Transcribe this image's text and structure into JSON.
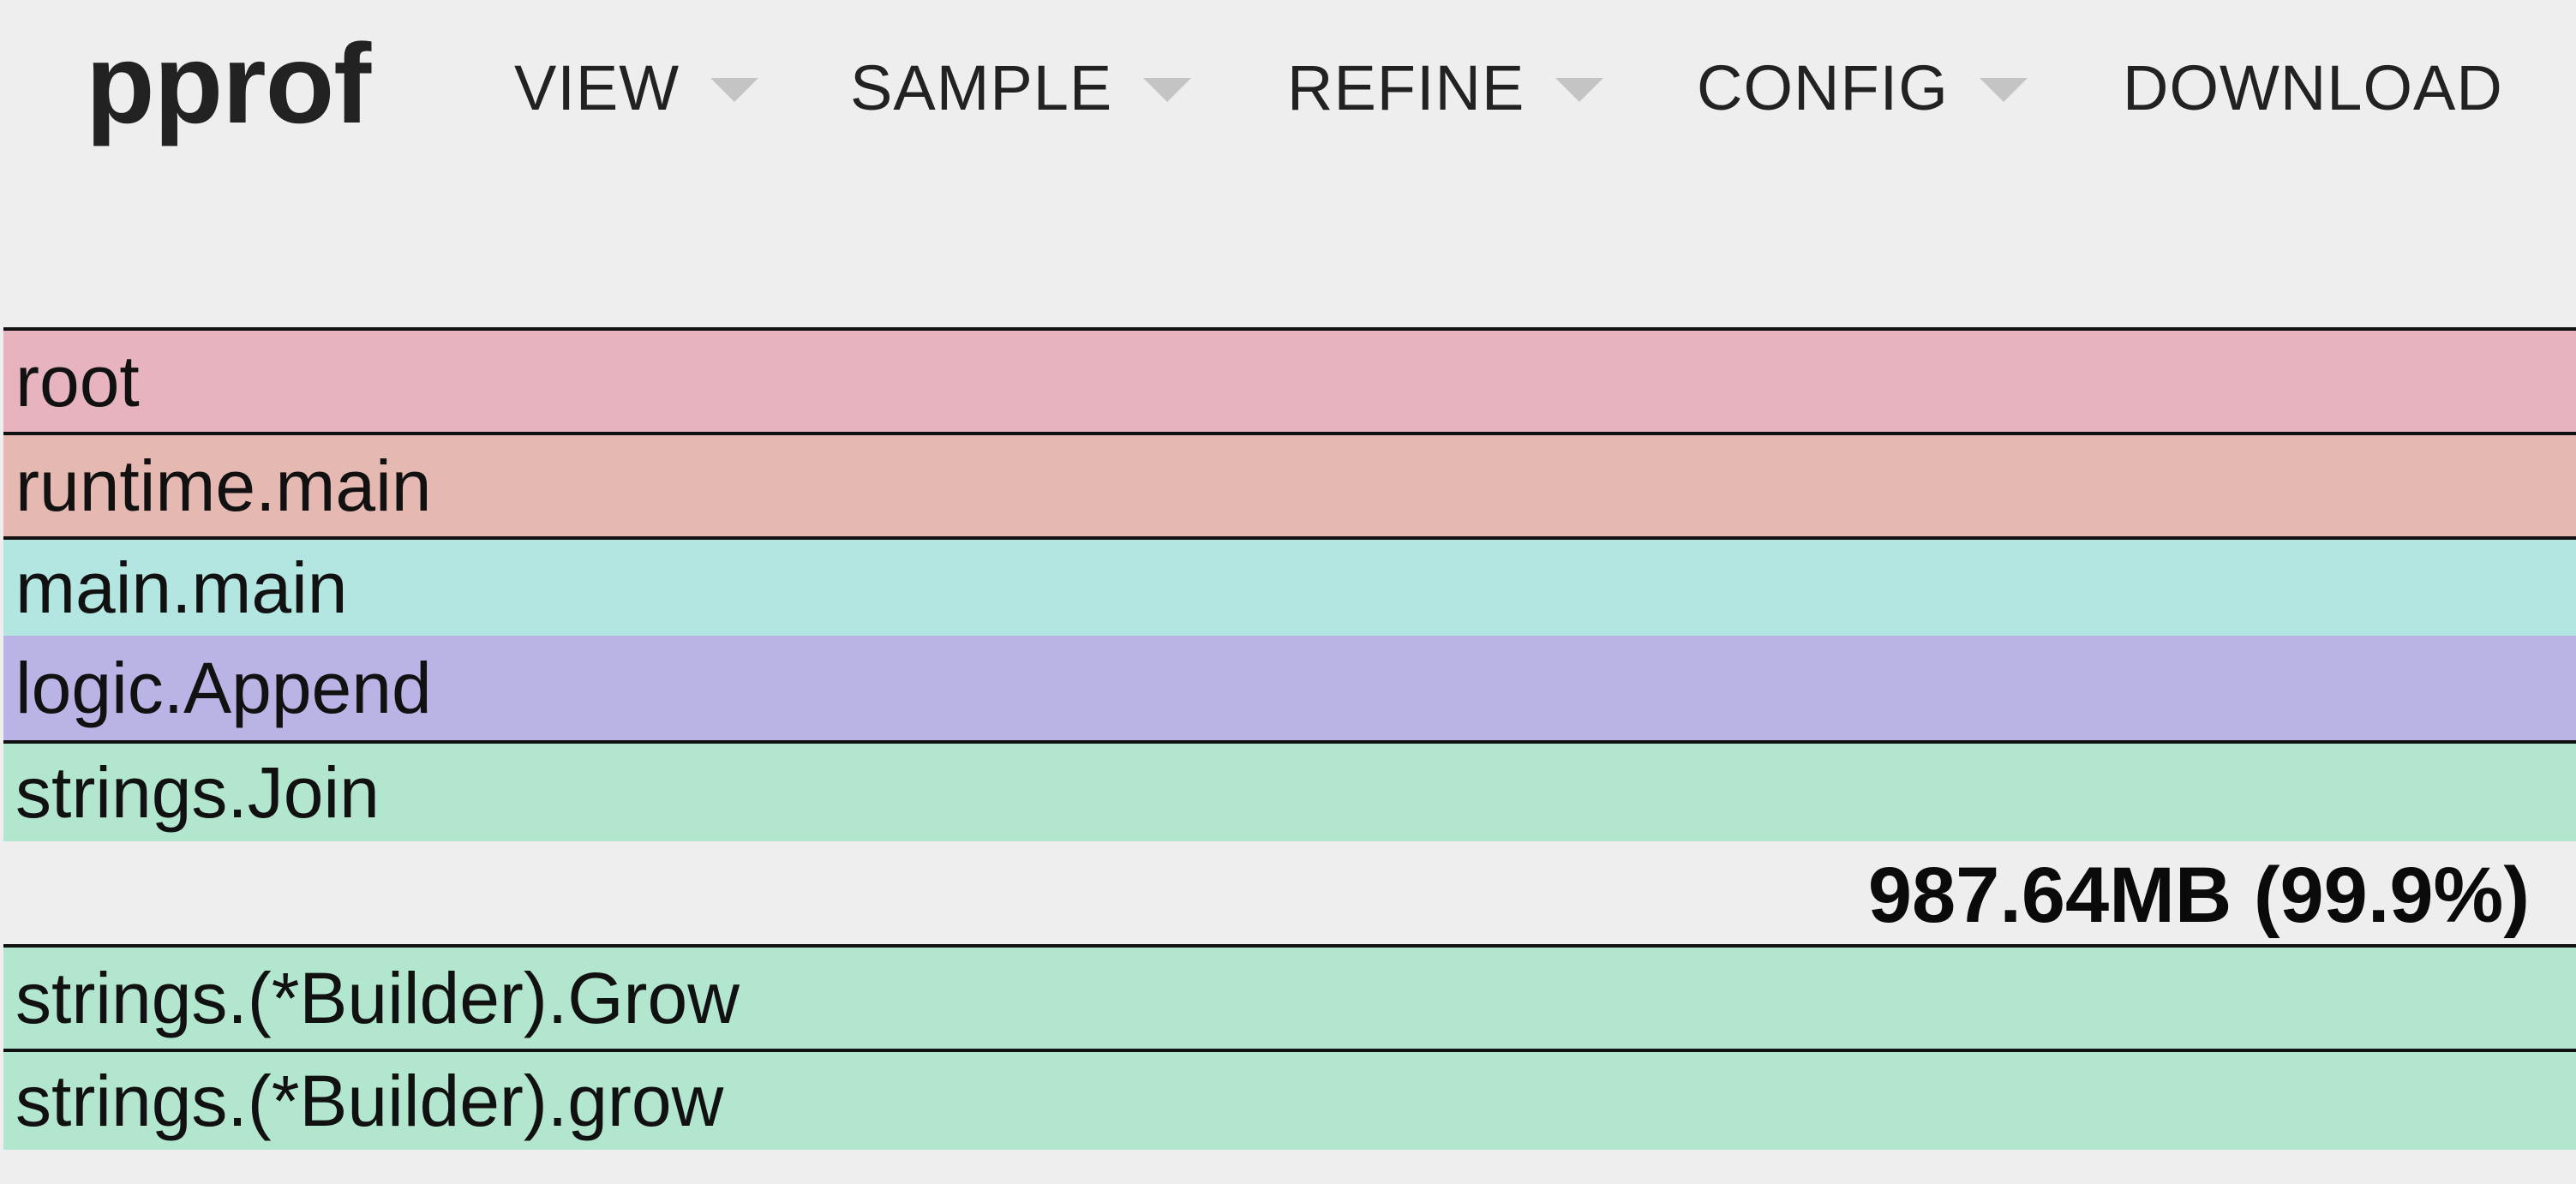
{
  "header": {
    "logo": "pprof",
    "menus": [
      {
        "label": "VIEW",
        "has_dropdown": true
      },
      {
        "label": "SAMPLE",
        "has_dropdown": true
      },
      {
        "label": "REFINE",
        "has_dropdown": true
      },
      {
        "label": "CONFIG",
        "has_dropdown": true
      },
      {
        "label": "DOWNLOAD",
        "has_dropdown": false
      }
    ]
  },
  "flamegraph": {
    "frames_top": [
      {
        "name": "root",
        "color": "#e7b3bf"
      },
      {
        "name": "runtime.main",
        "color": "#e6b8b2"
      },
      {
        "name": "main.main",
        "color": "#b3e5e1"
      },
      {
        "name": "logic.Append",
        "color": "#b9b3e6"
      },
      {
        "name": "strings.Join",
        "color": "#b3e6cf"
      }
    ],
    "selected_stat": "987.64MB (99.9%)",
    "frames_bottom": [
      {
        "name": "strings.(*Builder).Grow",
        "color": "#b3e6cf"
      },
      {
        "name": "strings.(*Builder).grow",
        "color": "#b3e6cf"
      }
    ]
  }
}
